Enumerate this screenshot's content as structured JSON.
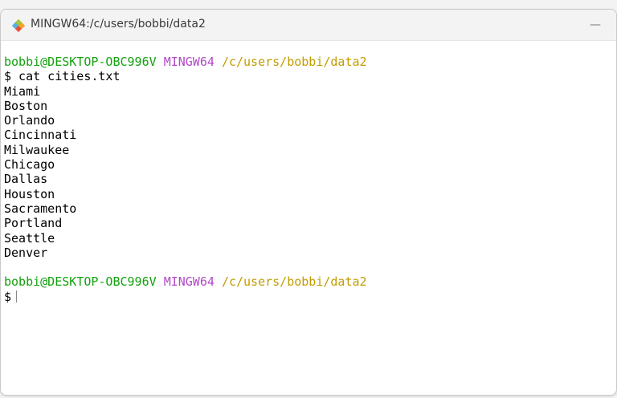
{
  "window": {
    "title": "MINGW64:/c/users/bobbi/data2",
    "minimize_label": "—",
    "app_icon": "git-bash-icon"
  },
  "terminal": {
    "prompt1": {
      "user_host": "bobbi@DESKTOP-OBC996V",
      "env": "MINGW64",
      "path": "/c/users/bobbi/data2"
    },
    "command1": "$ cat cities.txt",
    "output": [
      "Miami",
      "Boston",
      "Orlando",
      "Cincinnati",
      "Milwaukee",
      "Chicago",
      "Dallas",
      "Houston",
      "Sacramento",
      "Portland",
      "Seattle",
      "Denver"
    ],
    "prompt2": {
      "user_host": "bobbi@DESKTOP-OBC996V",
      "env": "MINGW64",
      "path": "/c/users/bobbi/data2"
    },
    "command2": "$"
  },
  "colors": {
    "user_host": "#13a10e",
    "env": "#b148c6",
    "path": "#c19c00"
  }
}
